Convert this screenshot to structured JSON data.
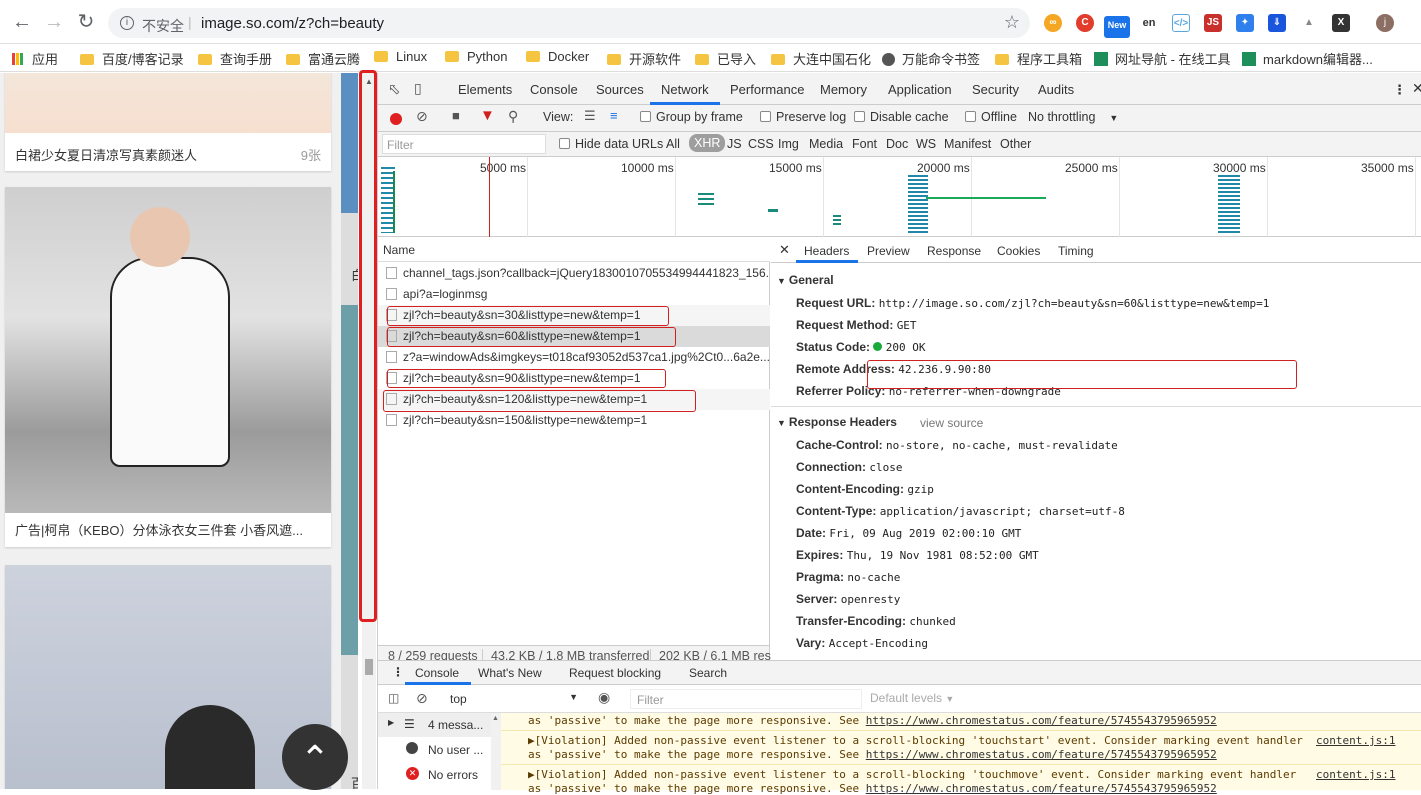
{
  "browser": {
    "security_label": "不安全",
    "url": "image.so.com/z?ch=beauty",
    "avatar_letter": "j",
    "ext_new_label": "New"
  },
  "bookmarks": [
    {
      "label": "应用"
    },
    {
      "label": "百度/博客记录"
    },
    {
      "label": "查询手册"
    },
    {
      "label": "富通云腾"
    },
    {
      "label": "Linux"
    },
    {
      "label": "Python"
    },
    {
      "label": "Docker"
    },
    {
      "label": "开源软件"
    },
    {
      "label": "已导入"
    },
    {
      "label": "大连中国石化"
    },
    {
      "label": "万能命令书签"
    },
    {
      "label": "程序工具箱"
    },
    {
      "label": "网址导航 - 在线工具"
    },
    {
      "label": "markdown编辑器..."
    }
  ],
  "page": {
    "cards": [
      {
        "caption": "白裙少女夏日清凉写真素颜迷人",
        "count": "9张"
      },
      {
        "caption": "广告|柯帛（KEBO）分体泳衣女三件套 小香风遮...",
        "count": ""
      }
    ],
    "side_label_1": "白",
    "side_label_2": "百"
  },
  "devtools": {
    "tabs": [
      "Elements",
      "Console",
      "Sources",
      "Network",
      "Performance",
      "Memory",
      "Application",
      "Security",
      "Audits"
    ],
    "selected_tab": "Network",
    "toolbar": {
      "view_label": "View:",
      "group_by_frame": "Group by frame",
      "preserve_log": "Preserve log",
      "disable_cache": "Disable cache",
      "offline": "Offline",
      "throttling": "No throttling"
    },
    "filter": {
      "placeholder": "Filter",
      "hide_data_urls": "Hide data URLs",
      "types": [
        "All",
        "XHR",
        "JS",
        "CSS",
        "Img",
        "Media",
        "Font",
        "Doc",
        "WS",
        "Manifest",
        "Other"
      ],
      "selected_type": "XHR"
    },
    "timeline_ticks": [
      "5000 ms",
      "10000 ms",
      "15000 ms",
      "20000 ms",
      "25000 ms",
      "30000 ms",
      "35000 ms"
    ],
    "list_header": "Name",
    "requests": [
      "channel_tags.json?callback=jQuery18300107055349944418​23_156...",
      "api?a=loginmsg",
      "zjl?ch=beauty&sn=30&listtype=new&temp=1",
      "zjl?ch=beauty&sn=60&listtype=new&temp=1",
      "z?a=windowAds&imgkeys=t018caf93052d537ca1.jpg%2Ct0...6a2e...",
      "zjl?ch=beauty&sn=90&listtype=new&temp=1",
      "zjl?ch=beauty&sn=120&listtype=new&temp=1",
      "zjl?ch=beauty&sn=150&listtype=new&temp=1"
    ],
    "status_bar": {
      "requests": "8 / 259 requests",
      "transferred": "43.2 KB / 1.8 MB transferred",
      "resources": "202 KB / 6.1 MB resc"
    },
    "detail_tabs": [
      "Headers",
      "Preview",
      "Response",
      "Cookies",
      "Timing"
    ],
    "general": {
      "title": "General",
      "request_url_k": "Request URL:",
      "request_url_v": "http://image.so.com/zjl?ch=beauty&sn=60&listtype=new&temp=1",
      "method_k": "Request Method:",
      "method_v": "GET",
      "status_k": "Status Code:",
      "status_v": "200 OK",
      "remote_k": "Remote Address:",
      "remote_v": "42.236.9.90:80",
      "referrer_k": "Referrer Policy:",
      "referrer_v": "no-referrer-when-downgrade"
    },
    "response_headers": {
      "title": "Response Headers",
      "view_source": "view source",
      "items": [
        {
          "k": "Cache-Control:",
          "v": "no-store, no-cache, must-revalidate"
        },
        {
          "k": "Connection:",
          "v": "close"
        },
        {
          "k": "Content-Encoding:",
          "v": "gzip"
        },
        {
          "k": "Content-Type:",
          "v": "application/javascript; charset=utf-8"
        },
        {
          "k": "Date:",
          "v": "Fri, 09 Aug 2019 02:00:10 GMT"
        },
        {
          "k": "Expires:",
          "v": "Thu, 19 Nov 1981 08:52:00 GMT"
        },
        {
          "k": "Pragma:",
          "v": "no-cache"
        },
        {
          "k": "Server:",
          "v": "openresty"
        },
        {
          "k": "Transfer-Encoding:",
          "v": "chunked"
        },
        {
          "k": "Vary:",
          "v": "Accept-Encoding"
        }
      ]
    },
    "drawer": {
      "tabs": [
        "Console",
        "What's New",
        "Request blocking",
        "Search"
      ],
      "context": "top",
      "filter_placeholder": "Filter",
      "levels": "Default levels",
      "sidebar": [
        "4 messa...",
        "No user ...",
        "No errors"
      ],
      "lines": [
        {
          "text": "as 'passive' to make the page more responsive. See ",
          "link": "https://www.chromestatus.com/feature/5745543795965952",
          "src": ""
        },
        {
          "text": "▶[Violation] Added non-passive event listener to a scroll-blocking 'touchstart' event. Consider marking event handler",
          "link": "",
          "src": "content.js:1"
        },
        {
          "text": "as 'passive' to make the page more responsive. See ",
          "link": "https://www.chromestatus.com/feature/5745543795965952",
          "src": ""
        },
        {
          "text": "▶[Violation] Added non-passive event listener to a scroll-blocking 'touchmove' event. Consider marking event handler",
          "link": "",
          "src": "content.js:1"
        },
        {
          "text": "as 'passive' to make the page more responsive. See ",
          "link": "https://www.chromestatus.com/feature/5745543795965952",
          "src": ""
        }
      ]
    }
  }
}
